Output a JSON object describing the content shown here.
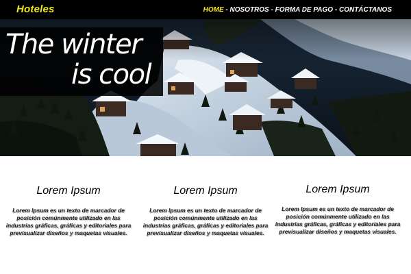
{
  "header": {
    "brand": "Hoteles",
    "nav": [
      {
        "label": "HOME",
        "active": true
      },
      {
        "label": "NOSOTROS",
        "active": false
      },
      {
        "label": "FORMA DE PAGO",
        "active": false
      },
      {
        "label": "CONTÁCTANOS",
        "active": false
      }
    ],
    "separator": " - "
  },
  "hero": {
    "title_line1": "The winter",
    "title_line2": "is cool"
  },
  "features": [
    {
      "title": "Lorem Ipsum",
      "text": "Lorem Ipsum es un texto de marcador de posición comúnmente utilizado en las industrias gráficas, gráficas y editoriales para previsualizar diseños y maquetas visuales."
    },
    {
      "title": "Lorem Ipsum",
      "text": "Lorem Ipsum es un texto de marcador de posición comúnmente utilizado en las industrias gráficas, gráficas y editoriales para previsualizar diseños y maquetas visuales."
    },
    {
      "title": "Lorem Ipsum",
      "text": "Lorem Ipsum es un texto de marcador de posición comúnmente utilizado en las industrias gráficas, gráficas y editoriales para previsualizar diseños y maquetas visuales."
    }
  ],
  "colors": {
    "accent": "#f2e51b",
    "navbar": "#000000"
  }
}
